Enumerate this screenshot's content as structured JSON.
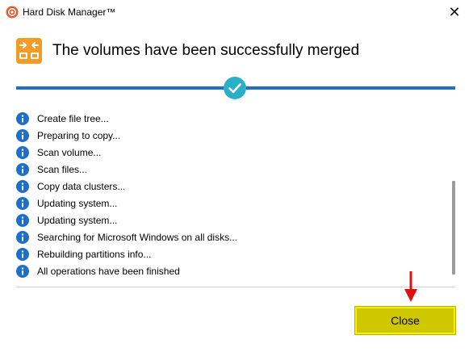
{
  "window": {
    "title": "Hard Disk Manager™",
    "icon": "app-logo-icon",
    "close_glyph": "✕"
  },
  "header": {
    "title": "The volumes have been successfully merged",
    "icon": "merge-volumes-icon",
    "accent_color": "#f29b26"
  },
  "progress": {
    "state": "complete",
    "value": 1.0,
    "color": "#1e6fc7",
    "icon": "checkmark-icon"
  },
  "log": {
    "icon": "info-icon",
    "icon_color": "#1e6fc7",
    "items": [
      "Create file tree...",
      "Preparing to copy...",
      "Scan volume...",
      "Scan files...",
      "Copy data clusters...",
      "Updating system...",
      "Updating system...",
      "Searching for Microsoft Windows on all disks...",
      "Rebuilding partitions info...",
      "All operations have been finished"
    ]
  },
  "footer": {
    "close_label": "Close",
    "highlight_color": "#cfc800",
    "annotation": "red-arrow-icon",
    "annotation_color": "#e01010"
  }
}
